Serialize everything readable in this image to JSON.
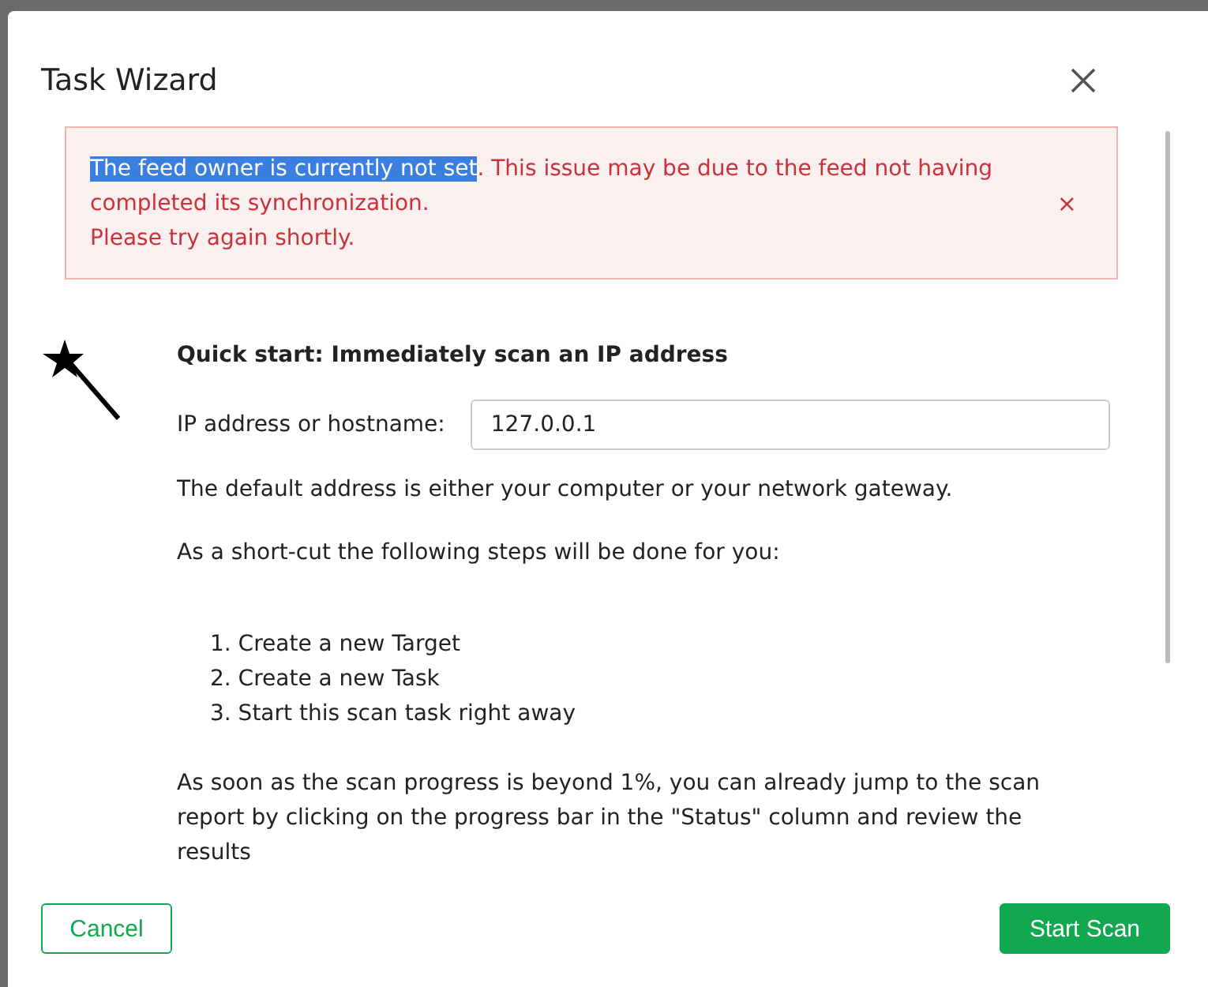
{
  "dialog": {
    "title": "Task Wizard"
  },
  "alert": {
    "selected_text": "The feed owner is currently not set",
    "text": ". This issue may be due to the feed not having completed its synchronization.",
    "line_2": "Please try again shortly.",
    "close": "×"
  },
  "quick_start": {
    "heading": "Quick start: Immediately scan an IP address",
    "field_label": "IP address or hostname:",
    "field_value": "127.0.0.1",
    "note": "The default address is either your computer or your network gateway.",
    "steps_intro": "As a short-cut the following steps will be done for you:",
    "steps": [
      "1. Create a new Target",
      "2. Create a new Task",
      "3. Start this scan task right away"
    ],
    "progress_note": "As soon as the scan progress is beyond 1%, you can already jump to the scan report by clicking on the progress bar in the \"Status\" column and review the results"
  },
  "buttons": {
    "cancel": "Cancel",
    "submit": "Start Scan"
  }
}
